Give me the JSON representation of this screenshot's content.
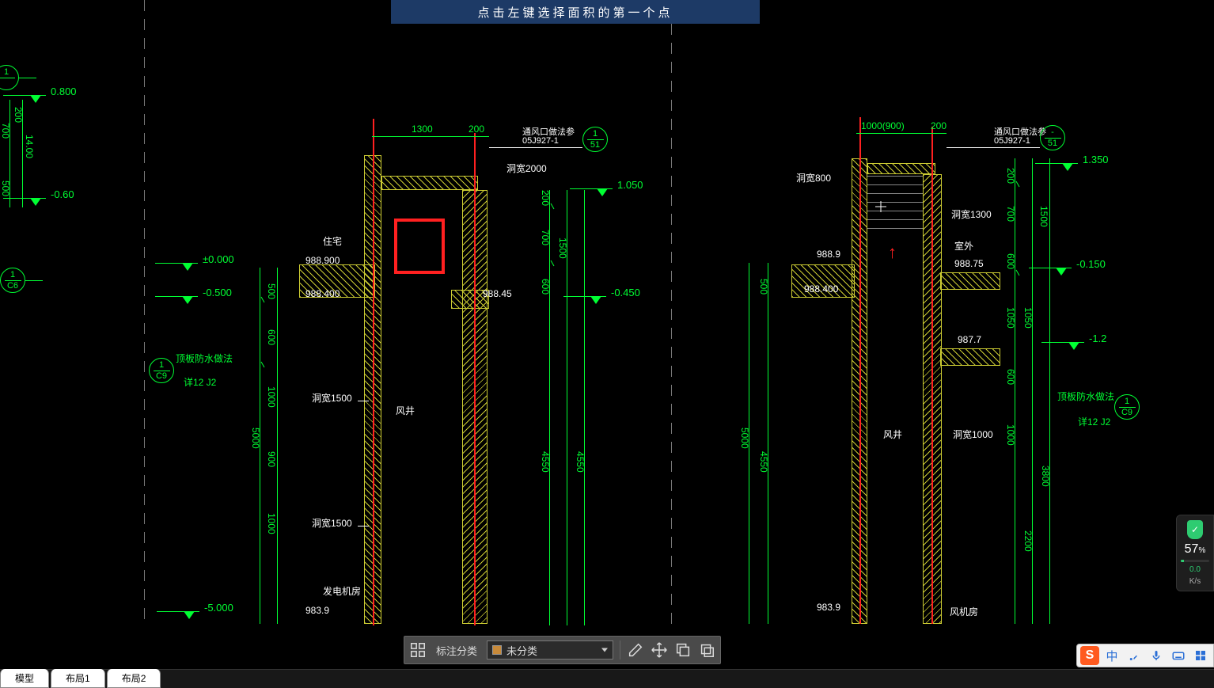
{
  "prompt": "点击左键选择面积的第一个点",
  "tabs": {
    "model": "模型",
    "layout1": "布局1",
    "layout2": "布局2"
  },
  "toolbar": {
    "label": "标注分类",
    "select_value": "未分类"
  },
  "ime": {
    "logo": "S",
    "cn": "中"
  },
  "net": {
    "pct": "57",
    "unit": "%",
    "rate": "K/s",
    "zero": "0.0"
  },
  "bubbles": {
    "b1": {
      "top": "1"
    },
    "c6": {
      "top": "1",
      "bot": "C6"
    },
    "c9l": {
      "top": "1",
      "bot": "C9"
    },
    "s1a": {
      "top": "1",
      "bot": "51"
    },
    "s1b": {
      "top": "-",
      "bot": "51"
    },
    "c9r": {
      "top": "1",
      "bot": "C9"
    }
  },
  "left": {
    "lv1": "0.800",
    "lv2": "-0.60",
    "d700": "700",
    "d200": "200",
    "d500": "500",
    "d1400": "14.00"
  },
  "sec_a": {
    "pm0": "±0.000",
    "m05": "-0.500",
    "m5": "-5.000",
    "roof": "顶板防水做法",
    "ref": "详12 J2",
    "d500": "500",
    "d600": "600",
    "d1000a": "1000",
    "d5000": "5000",
    "d900": "900",
    "d1000b": "1000"
  },
  "sec_b": {
    "e1": "988.900",
    "e2": "988.400",
    "e3": "983.9",
    "room1": "住宅",
    "room2": "风井",
    "room3": "发电机房",
    "hk1": "洞宽1500",
    "hk2": "洞宽1500",
    "d1300": "1300",
    "d200": "200"
  },
  "sec_c": {
    "title1": "通风口做法参",
    "title2": "05J927-1",
    "hk": "洞宽2000",
    "e1": "988.45",
    "lv1": "1.050",
    "lv2": "-0.450",
    "d200": "200",
    "d700": "700",
    "d600": "600",
    "d1500": "1500",
    "d4550a": "4550",
    "d4550b": "4550"
  },
  "sec_d": {
    "hk": "洞宽800",
    "e1": "988.9",
    "e2": "988.400",
    "e3": "983.9",
    "d500": "500",
    "d5000": "5000",
    "d4550": "4550",
    "d1000": "1000(900)",
    "d200": "200",
    "room": "风井"
  },
  "sec_e": {
    "title1": "通风口做法参",
    "title2": "05J927-1",
    "hk1": "洞宽1300",
    "hk2": "洞宽1000",
    "room1": "室外",
    "room2": "风机房",
    "e1": "988.75",
    "e2": "987.7",
    "lv1": "1.350",
    "lv2": "-0.150",
    "lv3": "-1.2",
    "roof": "顶板防水做法",
    "ref": "详12 J2",
    "d200": "200",
    "d700": "700",
    "d1500": "1500",
    "d600a": "600",
    "d1050a": "1050",
    "d1050b": "1050",
    "d600b": "600",
    "d1000": "1000",
    "d3800": "3800",
    "d2200": "2200"
  }
}
